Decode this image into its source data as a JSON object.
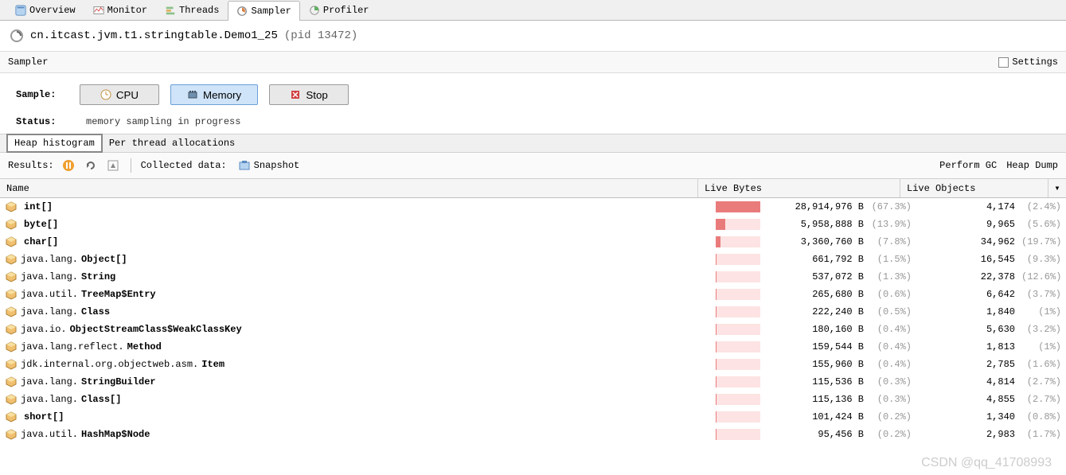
{
  "tabs": [
    {
      "label": "Overview",
      "icon": "overview"
    },
    {
      "label": "Monitor",
      "icon": "monitor"
    },
    {
      "label": "Threads",
      "icon": "threads"
    },
    {
      "label": "Sampler",
      "icon": "sampler",
      "active": true
    },
    {
      "label": "Profiler",
      "icon": "profiler"
    }
  ],
  "title": {
    "class": "cn.itcast.jvm.t1.stringtable.Demo1_25",
    "pid": "(pid 13472)"
  },
  "section": {
    "name": "Sampler",
    "settings_label": "Settings"
  },
  "sample": {
    "label": "Sample:",
    "cpu_btn": "CPU",
    "memory_btn": "Memory",
    "stop_btn": "Stop"
  },
  "status": {
    "label": "Status:",
    "value": "memory sampling in progress"
  },
  "sub_tabs": {
    "histogram": "Heap histogram",
    "per_thread": "Per thread allocations"
  },
  "toolbar": {
    "results_label": "Results:",
    "collected_label": "Collected data:",
    "snapshot_label": "Snapshot",
    "perform_gc": "Perform GC",
    "heap_dump": "Heap Dump"
  },
  "columns": {
    "name": "Name",
    "bytes": "Live Bytes",
    "objects": "Live Objects"
  },
  "rows": [
    {
      "pkg": "",
      "cls": "int[]",
      "bytes": "28,914,976 B",
      "bytes_pct": "(67.3%)",
      "bar": 67.3,
      "objects": "4,174",
      "obj_pct": "(2.4%)"
    },
    {
      "pkg": "",
      "cls": "byte[]",
      "bytes": "5,958,888 B",
      "bytes_pct": "(13.9%)",
      "bar": 13.9,
      "objects": "9,965",
      "obj_pct": "(5.6%)"
    },
    {
      "pkg": "",
      "cls": "char[]",
      "bytes": "3,360,760 B",
      "bytes_pct": "(7.8%)",
      "bar": 7.8,
      "objects": "34,962",
      "obj_pct": "(19.7%)"
    },
    {
      "pkg": "java.lang. ",
      "cls": "Object[]",
      "bytes": "661,792 B",
      "bytes_pct": "(1.5%)",
      "bar": 1.5,
      "objects": "16,545",
      "obj_pct": "(9.3%)"
    },
    {
      "pkg": "java.lang. ",
      "cls": "String",
      "bytes": "537,072 B",
      "bytes_pct": "(1.3%)",
      "bar": 1.3,
      "objects": "22,378",
      "obj_pct": "(12.6%)"
    },
    {
      "pkg": "java.util. ",
      "cls": "TreeMap$Entry",
      "bytes": "265,680 B",
      "bytes_pct": "(0.6%)",
      "bar": 0.6,
      "objects": "6,642",
      "obj_pct": "(3.7%)"
    },
    {
      "pkg": "java.lang. ",
      "cls": "Class",
      "bytes": "222,240 B",
      "bytes_pct": "(0.5%)",
      "bar": 0.5,
      "objects": "1,840",
      "obj_pct": "(1%)"
    },
    {
      "pkg": "java.io. ",
      "cls": "ObjectStreamClass$WeakClassKey",
      "bytes": "180,160 B",
      "bytes_pct": "(0.4%)",
      "bar": 0.4,
      "objects": "5,630",
      "obj_pct": "(3.2%)"
    },
    {
      "pkg": "java.lang.reflect. ",
      "cls": "Method",
      "bytes": "159,544 B",
      "bytes_pct": "(0.4%)",
      "bar": 0.4,
      "objects": "1,813",
      "obj_pct": "(1%)"
    },
    {
      "pkg": "jdk.internal.org.objectweb.asm.  ",
      "cls": "Item",
      "bytes": "155,960 B",
      "bytes_pct": "(0.4%)",
      "bar": 0.4,
      "objects": "2,785",
      "obj_pct": "(1.6%)"
    },
    {
      "pkg": "java.lang. ",
      "cls": "StringBuilder",
      "bytes": "115,536 B",
      "bytes_pct": "(0.3%)",
      "bar": 0.3,
      "objects": "4,814",
      "obj_pct": "(2.7%)"
    },
    {
      "pkg": "java.lang. ",
      "cls": "Class[]",
      "bytes": "115,136 B",
      "bytes_pct": "(0.3%)",
      "bar": 0.3,
      "objects": "4,855",
      "obj_pct": "(2.7%)"
    },
    {
      "pkg": "",
      "cls": "short[]",
      "bytes": "101,424 B",
      "bytes_pct": "(0.2%)",
      "bar": 0.2,
      "objects": "1,340",
      "obj_pct": "(0.8%)"
    },
    {
      "pkg": "java.util. ",
      "cls": "HashMap$Node",
      "bytes": "95,456 B",
      "bytes_pct": "(0.2%)",
      "bar": 0.2,
      "objects": "2,983",
      "obj_pct": "(1.7%)"
    }
  ],
  "watermark": "CSDN @qq_41708993"
}
